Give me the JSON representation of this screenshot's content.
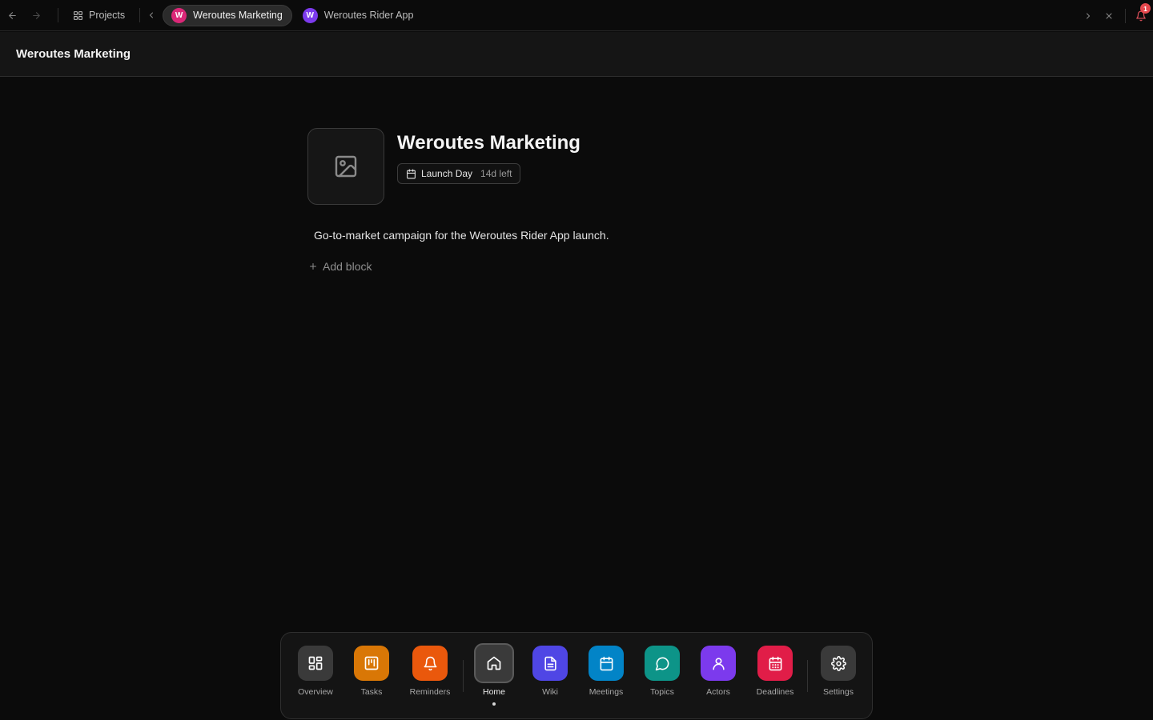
{
  "topbar": {
    "projects_label": "Projects",
    "tabs": [
      {
        "label": "Weroutes Marketing",
        "avatar": "W",
        "color": "#db2777",
        "active": true
      },
      {
        "label": "Weroutes Rider App",
        "avatar": "W",
        "color": "#7c3aed",
        "active": false
      }
    ],
    "notification_count": "1"
  },
  "header": {
    "title": "Weroutes Marketing"
  },
  "project": {
    "title": "Weroutes Marketing",
    "milestone_label": "Launch Day",
    "milestone_remaining": "14d left",
    "description": "Go-to-market campaign for the Weroutes Rider App launch.",
    "add_block_label": "Add block",
    "image_icon": "image-placeholder-icon"
  },
  "dock": {
    "items": [
      {
        "label": "Overview",
        "icon": "grid-icon",
        "color": "#3a3a3a"
      },
      {
        "label": "Tasks",
        "icon": "kanban-icon",
        "color": "#d97706"
      },
      {
        "label": "Reminders",
        "icon": "bell-icon",
        "color": "#ea580c"
      },
      {
        "label": "Home",
        "icon": "home-icon",
        "color": "#3a3a3a",
        "active": true
      },
      {
        "label": "Wiki",
        "icon": "document-icon",
        "color": "#4f46e5"
      },
      {
        "label": "Meetings",
        "icon": "calendar-icon",
        "color": "#0284c7"
      },
      {
        "label": "Topics",
        "icon": "chat-bubble-icon",
        "color": "#0d9488"
      },
      {
        "label": "Actors",
        "icon": "user-icon",
        "color": "#7c3aed"
      },
      {
        "label": "Deadlines",
        "icon": "calendar-grid-icon",
        "color": "#e11d48"
      },
      {
        "label": "Settings",
        "icon": "gear-icon",
        "color": "#3a3a3a"
      }
    ]
  }
}
